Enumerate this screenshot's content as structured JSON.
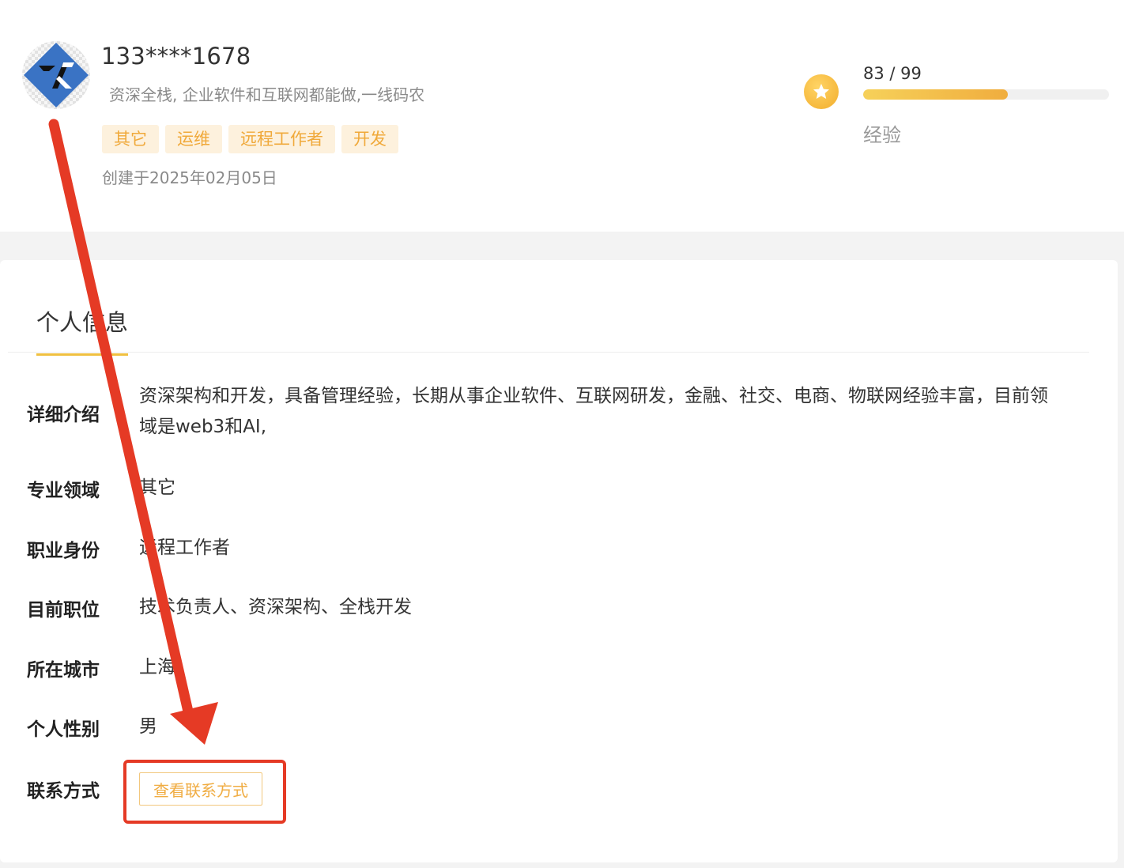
{
  "profile": {
    "username": "133****1678",
    "bio": "资深全栈, 企业软件和互联网都能做,一线码农",
    "tags": [
      "其它",
      "运维",
      "远程工作者",
      "开发"
    ],
    "created": "创建于2025年02月05日"
  },
  "experience": {
    "current": 83,
    "max": 99,
    "display": "83 / 99",
    "label": "经验",
    "progress_fraction": 0.59
  },
  "info": {
    "tab_label": "个人信息",
    "rows": [
      {
        "label": "详细介绍",
        "value": "资深架构和开发，具备管理经验，长期从事企业软件、互联网研发，金融、社交、电商、物联网经验丰富，目前领域是web3和AI,"
      },
      {
        "label": "专业领域",
        "value": "其它"
      },
      {
        "label": "职业身份",
        "value": "远程工作者"
      },
      {
        "label": "目前职位",
        "value": "技术负责人、资深架构、全栈开发"
      },
      {
        "label": "所在城市",
        "value": "上海"
      },
      {
        "label": "个人性别",
        "value": "男"
      },
      {
        "label": "联系方式",
        "button_label": "查看联系方式"
      }
    ]
  },
  "colors": {
    "accent": "#f0ac42",
    "tag_bg": "#fdf1dd",
    "annotation": "#e53a25"
  }
}
